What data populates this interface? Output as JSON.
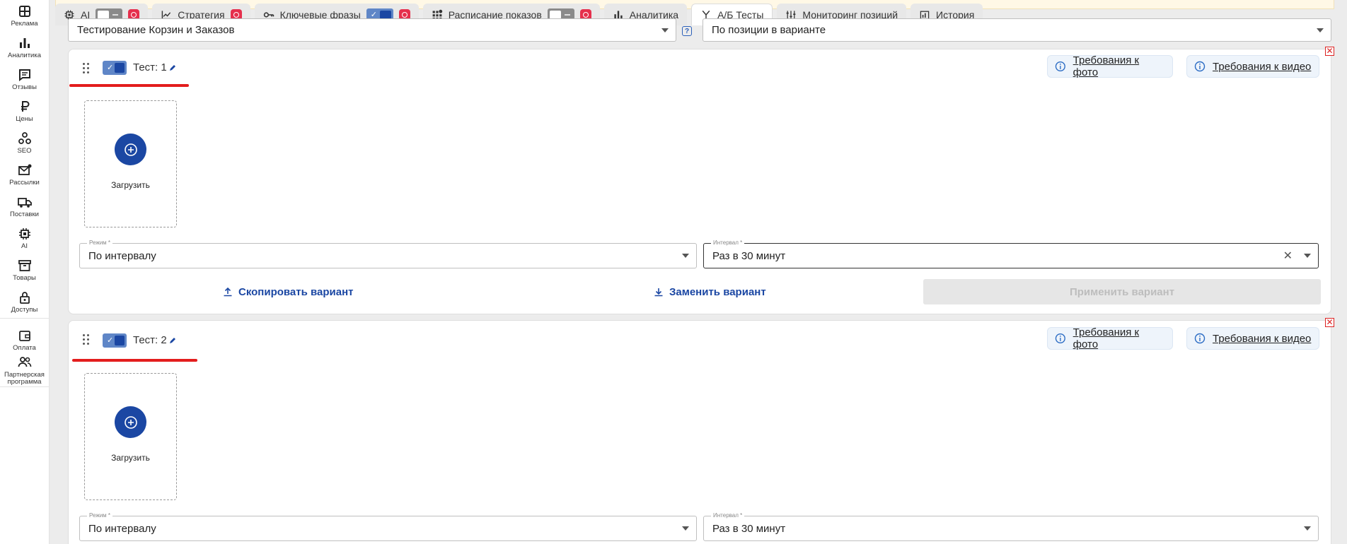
{
  "sidebar": {
    "items": [
      {
        "label": "Реклама",
        "icon": "dashboard-icon"
      },
      {
        "label": "Аналитика",
        "icon": "bar-chart-icon"
      },
      {
        "label": "Отзывы",
        "icon": "comment-icon"
      },
      {
        "label": "Цены",
        "icon": "ruble-icon"
      },
      {
        "label": "SEO",
        "icon": "seo-icon"
      },
      {
        "label": "Рассылки",
        "icon": "mail-icon"
      },
      {
        "label": "Поставки",
        "icon": "truck-icon"
      },
      {
        "label": "AI",
        "icon": "chip-icon"
      },
      {
        "label": "Товары",
        "icon": "archive-icon"
      },
      {
        "label": "Доступы",
        "icon": "lock-icon"
      }
    ],
    "bottom": [
      {
        "label": "Оплата",
        "icon": "wallet-icon"
      },
      {
        "label": "Партнерская программа",
        "icon": "partners-icon"
      }
    ]
  },
  "tabs": [
    {
      "label": "AI",
      "toggle": "off",
      "badge": true
    },
    {
      "label": "Стратегия",
      "badge": true
    },
    {
      "label": "Ключевые фразы",
      "toggle": "on",
      "badge": true
    },
    {
      "label": "Расписание показов",
      "toggle": "off",
      "badge": true
    },
    {
      "label": "Аналитика"
    },
    {
      "label": "А/Б Тесты",
      "active": true
    },
    {
      "label": "Мониторинг позиций"
    },
    {
      "label": "История"
    }
  ],
  "top": {
    "test_type": "Тестирование Корзин и Заказов",
    "sort": "По позиции в варианте",
    "help": "?"
  },
  "cards": [
    {
      "title": "Тест: 1",
      "req_photo": "Требования к фото",
      "req_video": "Требования к видео",
      "upload_label": "Загрузить",
      "mode_label": "Режим *",
      "mode_value": "По интервалу",
      "interval_label": "Интервал *",
      "interval_value": "Раз в 30 минут",
      "copy": "Скопировать вариант",
      "replace": "Заменить вариант",
      "apply": "Применить вариант"
    },
    {
      "title": "Тест: 2",
      "req_photo": "Требования к фото",
      "req_video": "Требования к видео",
      "upload_label": "Загрузить",
      "mode_label": "Режим *",
      "mode_value": "По интервалу",
      "interval_label": "Интервал *",
      "interval_value": "Раз в 30 минут"
    }
  ],
  "colors": {
    "accent": "#1b47a3",
    "danger": "#e31d1d",
    "info_bg": "#eef4fb"
  }
}
